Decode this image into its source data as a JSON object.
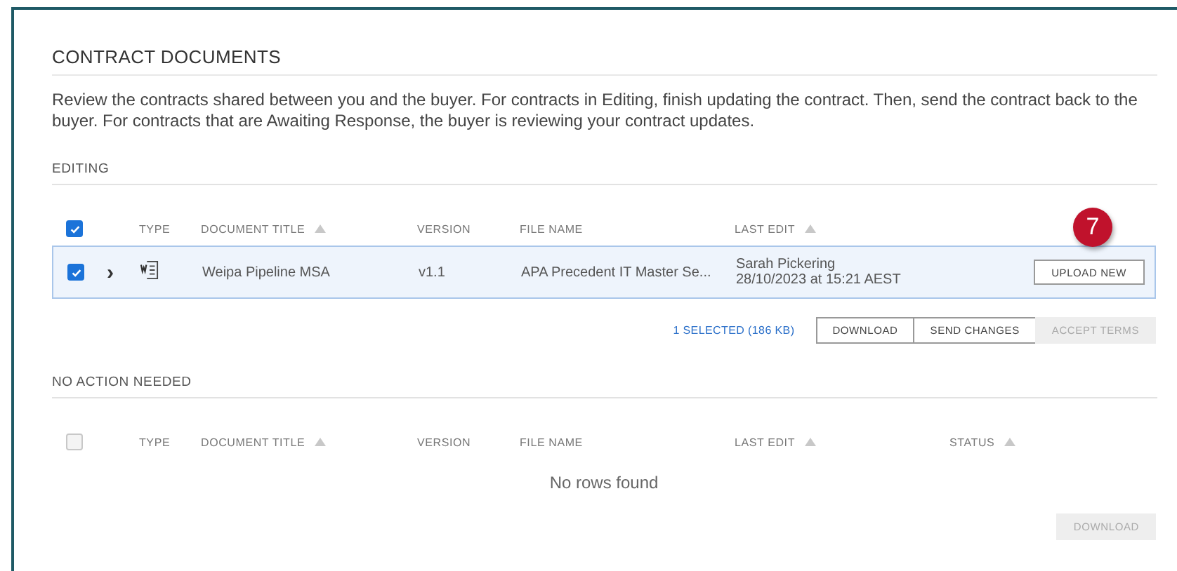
{
  "title": "CONTRACT DOCUMENTS",
  "description": "Review the contracts shared between you and the buyer. For contracts in Editing, finish updating the contract. Then, send the contract back to the buyer. For contracts that are Awaiting Response, the buyer is reviewing your contract updates.",
  "sections": [
    {
      "heading": "EDITING",
      "all_checked": true,
      "columns": [
        {
          "label": "TYPE",
          "sort_arrow": false
        },
        {
          "label": "DOCUMENT TITLE",
          "sort_arrow": true
        },
        {
          "label": "VERSION",
          "sort_arrow": false
        },
        {
          "label": "FILE NAME",
          "sort_arrow": false
        },
        {
          "label": "LAST EDIT",
          "sort_arrow": true
        }
      ],
      "rows": [
        {
          "checked": true,
          "selected": true,
          "expand": "›",
          "title": "Weipa Pipeline MSA",
          "version": "v1.1",
          "file_name": "APA Precedent IT Master Se...",
          "editor": "Sarah Pickering",
          "edited": "28/10/2023 at 15:21 AEST",
          "action": "UPLOAD NEW",
          "badge": "7"
        }
      ],
      "selection": "1 SELECTED (186 KB)",
      "buttons": [
        {
          "label": "DOWNLOAD",
          "disabled": false
        },
        {
          "label": "SEND CHANGES",
          "disabled": false
        },
        {
          "label": "ACCEPT TERMS",
          "disabled": true
        }
      ]
    },
    {
      "heading": "NO ACTION NEEDED",
      "all_checked": false,
      "columns": [
        {
          "label": "TYPE",
          "sort_arrow": false
        },
        {
          "label": "DOCUMENT TITLE",
          "sort_arrow": true
        },
        {
          "label": "VERSION",
          "sort_arrow": false
        },
        {
          "label": "FILE NAME",
          "sort_arrow": false
        },
        {
          "label": "LAST EDIT",
          "sort_arrow": true
        },
        {
          "label": "STATUS",
          "sort_arrow": true
        }
      ],
      "empty_text": "No rows found",
      "buttons": [
        {
          "label": "DOWNLOAD",
          "disabled": true
        }
      ]
    }
  ]
}
